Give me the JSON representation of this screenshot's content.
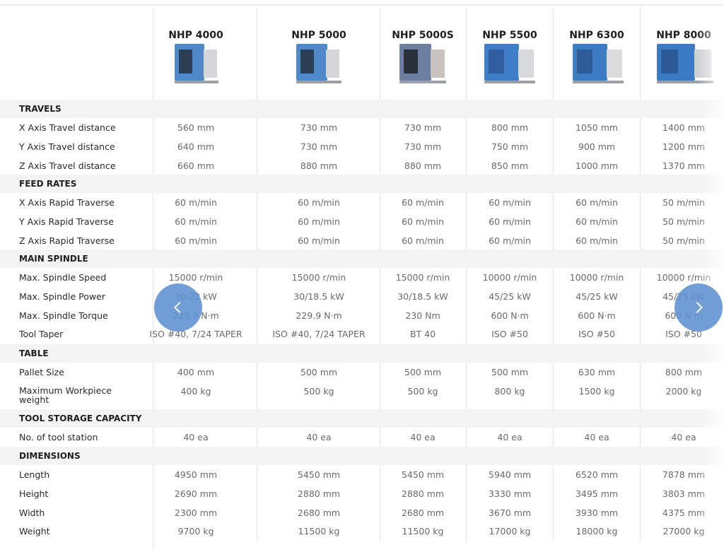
{
  "models": [
    {
      "name": "NHP 4000",
      "image_icon": "machine-image-icon"
    },
    {
      "name": "NHP 5000",
      "image_icon": "machine-image-icon"
    },
    {
      "name": "NHP 5000S",
      "image_icon": "machine-image-icon"
    },
    {
      "name": "NHP 5500",
      "image_icon": "machine-image-icon"
    },
    {
      "name": "NHP 6300",
      "image_icon": "machine-image-icon"
    },
    {
      "name": "NHP 8000",
      "image_icon": "machine-image-icon"
    }
  ],
  "sections": [
    {
      "title": "TRAVELS",
      "rows": [
        {
          "label": "X Axis Travel distance",
          "values": [
            "560 mm",
            "730 mm",
            "730 mm",
            "800 mm",
            "1050 mm",
            "1400 mm"
          ]
        },
        {
          "label": "Y Axis Travel distance",
          "values": [
            "640 mm",
            "730 mm",
            "730 mm",
            "750 mm",
            "900 mm",
            "1200 mm"
          ]
        },
        {
          "label": "Z Axis Travel distance",
          "values": [
            "660 mm",
            "880 mm",
            "880 mm",
            "850 mm",
            "1000 mm",
            "1370 mm"
          ]
        }
      ]
    },
    {
      "title": "FEED RATES",
      "rows": [
        {
          "label": "X Axis Rapid Traverse",
          "values": [
            "60 m/min",
            "60 m/min",
            "60 m/min",
            "60 m/min",
            "60 m/min",
            "50 m/min"
          ]
        },
        {
          "label": "Y Axis Rapid Traverse",
          "values": [
            "60 m/min",
            "60 m/min",
            "60 m/min",
            "60 m/min",
            "60 m/min",
            "50 m/min"
          ]
        },
        {
          "label": "Z Axis Rapid Traverse",
          "values": [
            "60 m/min",
            "60 m/min",
            "60 m/min",
            "60 m/min",
            "60 m/min",
            "50 m/min"
          ]
        }
      ]
    },
    {
      "title": "MAIN SPINDLE",
      "rows": [
        {
          "label": "Max. Spindle Speed",
          "values": [
            "15000 r/min",
            "15000 r/min",
            "15000 r/min",
            "10000 r/min",
            "10000 r/min",
            "10000 r/min"
          ]
        },
        {
          "label": "Max. Spindle Power",
          "values": [
            "30/22 kW",
            "30/18.5 kW",
            "30/18.5 kW",
            "45/25 kW",
            "45/25 kW",
            "45/25 kW"
          ]
        },
        {
          "label": "Max. Spindle Torque",
          "values": [
            "229.9 N·m",
            "229.9 N·m",
            "230 Nm",
            "600 N·m",
            "600 N·m",
            "600 N·m"
          ]
        },
        {
          "label": "Tool Taper",
          "values": [
            "ISO #40, 7/24 TAPER",
            "ISO #40, 7/24 TAPER",
            "BT 40",
            "ISO #50",
            "ISO #50",
            "ISO #50"
          ]
        }
      ]
    },
    {
      "title": "TABLE",
      "rows": [
        {
          "label": "Pallet Size",
          "values": [
            "400 mm",
            "500 mm",
            "500 mm",
            "500 mm",
            "630 mm",
            "800 mm"
          ]
        },
        {
          "label": "Maximum Workpiece\nweight",
          "values": [
            "400 kg",
            "500 kg",
            "500 kg",
            "800 kg",
            "1500 kg",
            "2000 kg"
          ]
        }
      ]
    },
    {
      "title": "TOOL STORAGE CAPACITY",
      "rows": [
        {
          "label": "No. of tool station",
          "values": [
            "40 ea",
            "40 ea",
            "40 ea",
            "40 ea",
            "40 ea",
            "40 ea"
          ]
        }
      ]
    },
    {
      "title": "DIMENSIONS",
      "rows": [
        {
          "label": "Length",
          "values": [
            "4950 mm",
            "5450 mm",
            "5450 mm",
            "5940 mm",
            "6520 mm",
            "7878 mm"
          ]
        },
        {
          "label": "Height",
          "values": [
            "2690 mm",
            "2880 mm",
            "2880 mm",
            "3330 mm",
            "3495 mm",
            "3803 mm"
          ]
        },
        {
          "label": "Width",
          "values": [
            "2300 mm",
            "2680 mm",
            "2680 mm",
            "3670 mm",
            "3930 mm",
            "4375 mm"
          ]
        },
        {
          "label": "Weight",
          "values": [
            "9700 kg",
            "11500 kg",
            "11500 kg",
            "17000 kg",
            "18000 kg",
            "27000 kg"
          ]
        }
      ]
    }
  ],
  "navigation": {
    "prev_icon": "chevron-left-icon",
    "next_icon": "chevron-right-icon"
  },
  "colors": {
    "nav_button": "#5d91d0",
    "section_band": "#f3f3f3",
    "value_text": "#6a6a6a",
    "label_text": "#2a2a2a"
  }
}
